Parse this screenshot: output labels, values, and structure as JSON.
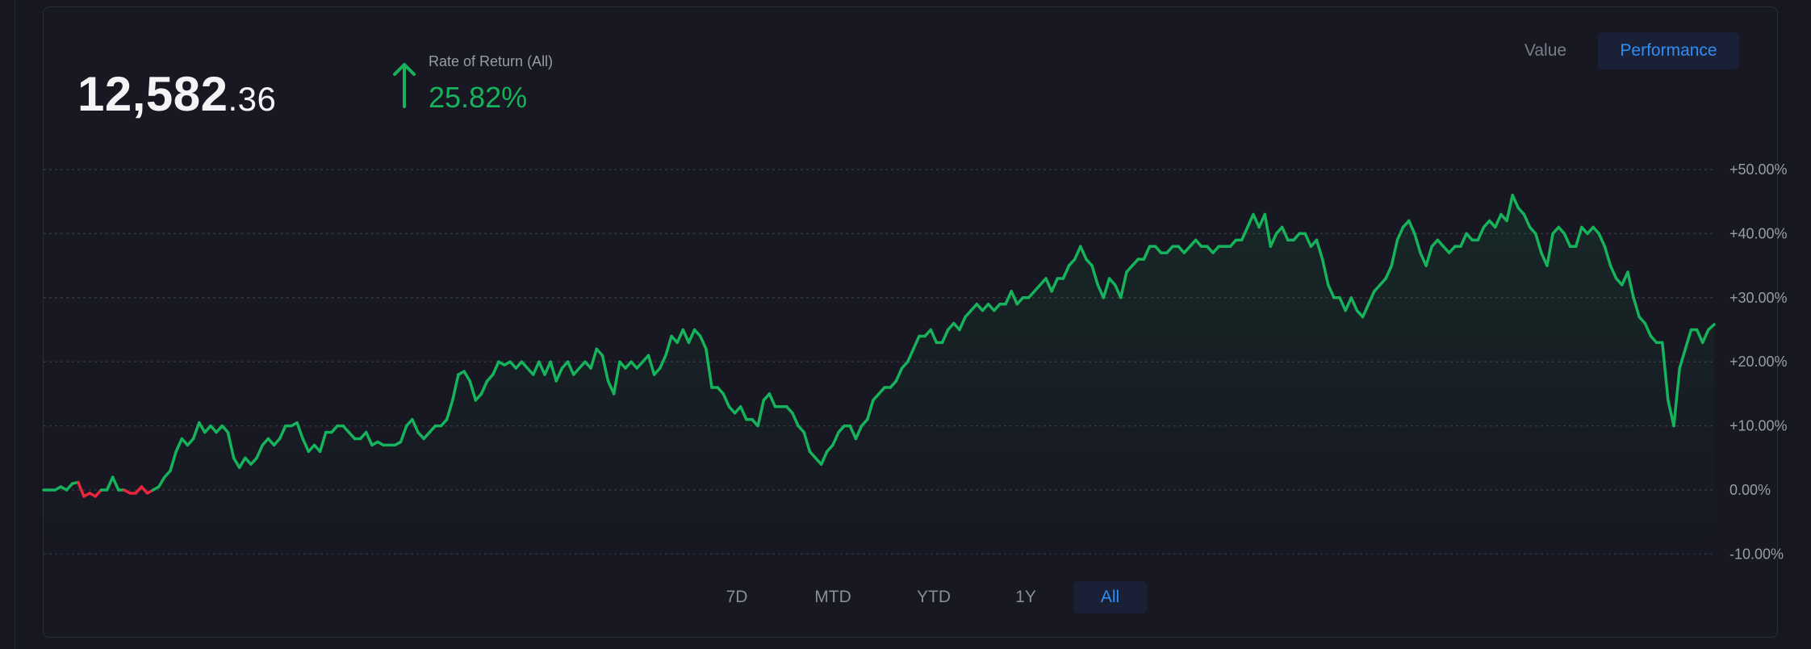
{
  "balance": {
    "whole": "12,582",
    "cents": ".36"
  },
  "rate_of_return": {
    "label": "Rate of Return (All)",
    "value": "25.82%",
    "direction_icon": "arrow-up-icon"
  },
  "view_toggle": [
    {
      "label": "Value",
      "active": false
    },
    {
      "label": "Performance",
      "active": true
    }
  ],
  "ranges": [
    {
      "label": "7D",
      "active": false
    },
    {
      "label": "MTD",
      "active": false
    },
    {
      "label": "YTD",
      "active": false
    },
    {
      "label": "1Y",
      "active": false
    },
    {
      "label": "All",
      "active": true
    }
  ],
  "colors": {
    "positive": "#16b35c",
    "negative": "#e8263f",
    "accent": "#2f8df5"
  },
  "chart_data": {
    "type": "line",
    "title": "",
    "xlabel": "",
    "ylabel": "",
    "ylim": [
      -10,
      50
    ],
    "y_ticks": [
      {
        "value": 50,
        "label": "+50.00%"
      },
      {
        "value": 40,
        "label": "+40.00%"
      },
      {
        "value": 30,
        "label": "+30.00%"
      },
      {
        "value": 20,
        "label": "+20.00%"
      },
      {
        "value": 10,
        "label": "+10.00%"
      },
      {
        "value": 0,
        "label": "0.00%"
      },
      {
        "value": -10,
        "label": "-10.00%"
      }
    ],
    "grid": true,
    "series": [
      {
        "name": "Rate of Return",
        "values": [
          0,
          0,
          0,
          0.5,
          0,
          1,
          1.2,
          -1,
          -0.5,
          -1,
          0,
          0,
          2,
          0,
          0,
          -0.5,
          -0.5,
          0.5,
          -0.5,
          0,
          0.5,
          2,
          3,
          6,
          8,
          7,
          8,
          10.5,
          9,
          10,
          9,
          10,
          9,
          5,
          3.5,
          5,
          4,
          5,
          7,
          8,
          7,
          8,
          10,
          10,
          10.5,
          8,
          6,
          7,
          6,
          9,
          9,
          10,
          10,
          9,
          8,
          8,
          9,
          7,
          7.5,
          7,
          7,
          7,
          7.5,
          10,
          11,
          9,
          8,
          9,
          10,
          10,
          11,
          14,
          18,
          18.5,
          17,
          14,
          15,
          17,
          18,
          20,
          19.5,
          20,
          19,
          20,
          19,
          18,
          20,
          18,
          20,
          17,
          19,
          20,
          18,
          19,
          20,
          19,
          22,
          21,
          17,
          15,
          20,
          19,
          20,
          19,
          20,
          21,
          18,
          19,
          21,
          24,
          23,
          25,
          23,
          25,
          24,
          22,
          16,
          16,
          15,
          13,
          12,
          13,
          11,
          11,
          10,
          14,
          15,
          13,
          13,
          13,
          12,
          10,
          9,
          6,
          5,
          4,
          6,
          7,
          9,
          10,
          10,
          8,
          10,
          11,
          14,
          15,
          16,
          16,
          17,
          19,
          20,
          22,
          24,
          24,
          25,
          23,
          23,
          25,
          26,
          25,
          27,
          28,
          29,
          28,
          29,
          28,
          29,
          29,
          31,
          29,
          30,
          30,
          31,
          32,
          33,
          31,
          33,
          33,
          35,
          36,
          38,
          36,
          35,
          32,
          30,
          33,
          32,
          30,
          34,
          35,
          36,
          36,
          38,
          38,
          37,
          37,
          38,
          38,
          37,
          38,
          39,
          38,
          38,
          37,
          38,
          38,
          38,
          39,
          39,
          41,
          43,
          41,
          43,
          38,
          40,
          41,
          39,
          39,
          40,
          40,
          38,
          39,
          36,
          32,
          30,
          30,
          28,
          30,
          28,
          27,
          29,
          31,
          32,
          33,
          35,
          39,
          41,
          42,
          40,
          37,
          35,
          38,
          39,
          38,
          37,
          38,
          38,
          40,
          39,
          39,
          41,
          42,
          41,
          43,
          42,
          46,
          44,
          43,
          41,
          40,
          37,
          35,
          40,
          41,
          40,
          38,
          38,
          41,
          40,
          41,
          40,
          38,
          35,
          33,
          32,
          34,
          30,
          27,
          26,
          24,
          23,
          23,
          14,
          10,
          19,
          22,
          25,
          25,
          23,
          25,
          25.82
        ]
      }
    ]
  }
}
